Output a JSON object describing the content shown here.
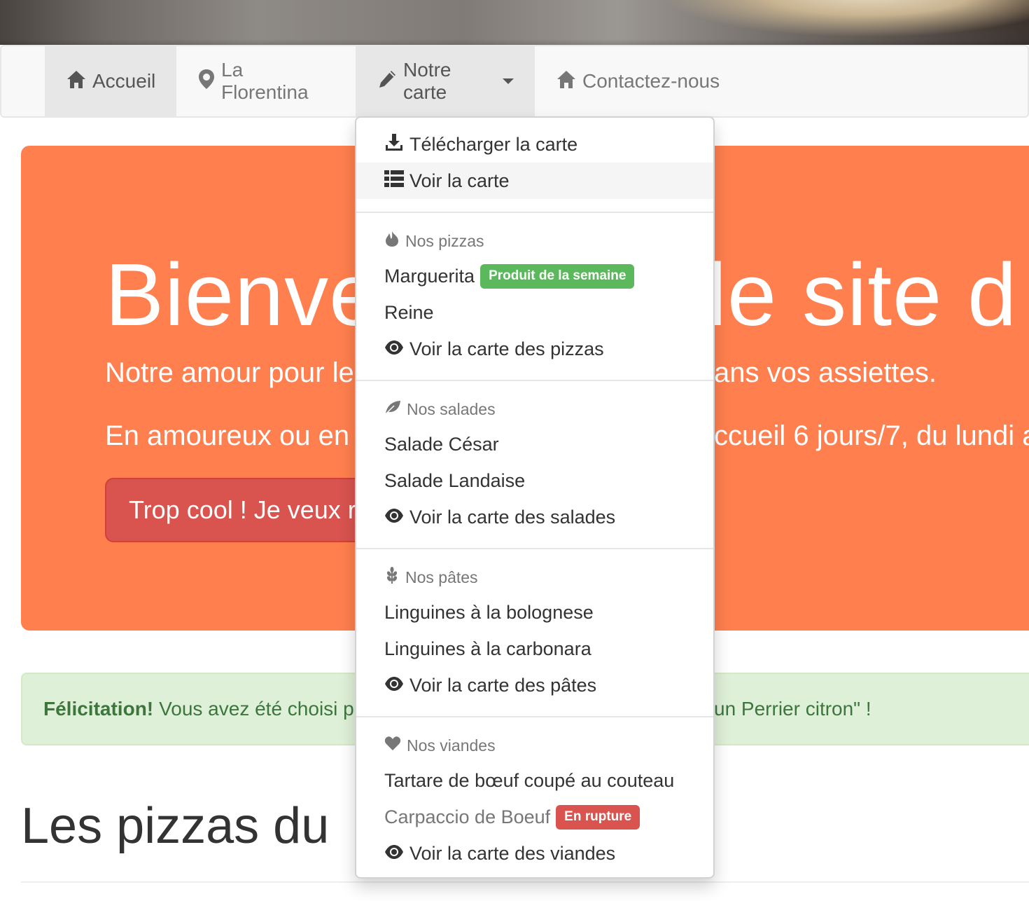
{
  "nav": {
    "items": [
      {
        "label": "Accueil",
        "icon": "home-icon"
      },
      {
        "label": "La Florentina",
        "icon": "map-marker-icon"
      },
      {
        "label": "Notre carte",
        "icon": "pencil-icon"
      },
      {
        "label": "Contactez-nous",
        "icon": "home-icon"
      }
    ]
  },
  "dropdown": {
    "download": "Télécharger la carte",
    "view": "Voir la carte",
    "pizzas": {
      "header": "Nos pizzas",
      "items": [
        "Marguerita",
        "Reine"
      ],
      "badge": "Produit de la semaine",
      "see_all": "Voir la carte des pizzas"
    },
    "salades": {
      "header": "Nos salades",
      "items": [
        "Salade César",
        "Salade Landaise"
      ],
      "see_all": "Voir la carte des salades"
    },
    "pates": {
      "header": "Nos pâtes",
      "items": [
        "Linguines à la bolognese",
        "Linguines à la carbonara"
      ],
      "see_all": "Voir la carte des pâtes"
    },
    "viandes": {
      "header": "Nos viandes",
      "items": [
        "Tartare de bœuf coupé au couteau",
        "Carpaccio de Boeuf"
      ],
      "badge": "En rupture",
      "see_all": "Voir la carte des viandes"
    }
  },
  "jumbotron": {
    "title_left": "Bienve",
    "title_right": "le site d",
    "line1_left": "Notre amour pour le",
    "line1_right": "ans vos assiettes.",
    "line2_left": "En amoureux ou en",
    "line2_right": "ccueil 6 jours/7, du lundi a",
    "button": "Trop cool ! Je veux r"
  },
  "alert": {
    "strong": "Félicitation!",
    "text_left": "Vous avez été choisi po",
    "text_right": "un Perrier citron\" !"
  },
  "section": {
    "title": "Les pizzas du"
  },
  "colors": {
    "jumbotron": "#ff7f4e",
    "button": "#d9534f",
    "success": "#5cb85c",
    "danger": "#d9534f",
    "alert_bg": "#dff0d8",
    "alert_text": "#3c763d"
  }
}
